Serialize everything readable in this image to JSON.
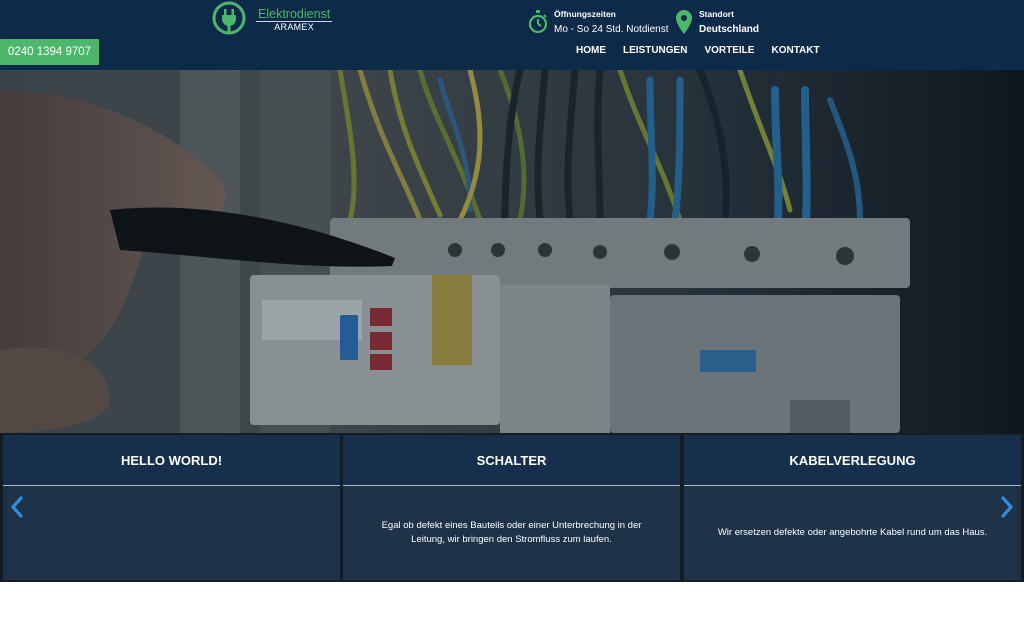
{
  "header": {
    "logo": {
      "title": "Elektrodienst",
      "subtitle": "ARAMEX",
      "icon": "plug-icon"
    },
    "phone": "0240 1394 9707",
    "hours": {
      "label": "Öffnungszeiten",
      "value": "Mo - So 24 Std. Notdienst",
      "icon": "stopwatch-icon"
    },
    "location": {
      "label": "Standort",
      "value": "Deutschland",
      "icon": "map-pin-icon"
    },
    "nav": [
      {
        "label": "HOME"
      },
      {
        "label": "LEISTUNGEN"
      },
      {
        "label": "VORTEILE"
      },
      {
        "label": "KONTAKT"
      }
    ]
  },
  "hero": {
    "image": "electrician-fuse-box-photo"
  },
  "cards": [
    {
      "title": "HELLO WORLD!",
      "text": ""
    },
    {
      "title": "SCHALTER",
      "text": "Egal ob defekt eines Bauteils oder einer Unterbrechung in der Leitung, wir bringen den Stromfluss zum laufen."
    },
    {
      "title": "KABELVERLEGUNG",
      "text": "Wir ersetzen defekte oder angebohrte Kabel rund um das Haus."
    }
  ],
  "colors": {
    "header_bg": "#0e2a49",
    "accent_green": "#4cb76a",
    "card_bg": "#1e3248",
    "arrow_blue": "#2e8fe0"
  }
}
